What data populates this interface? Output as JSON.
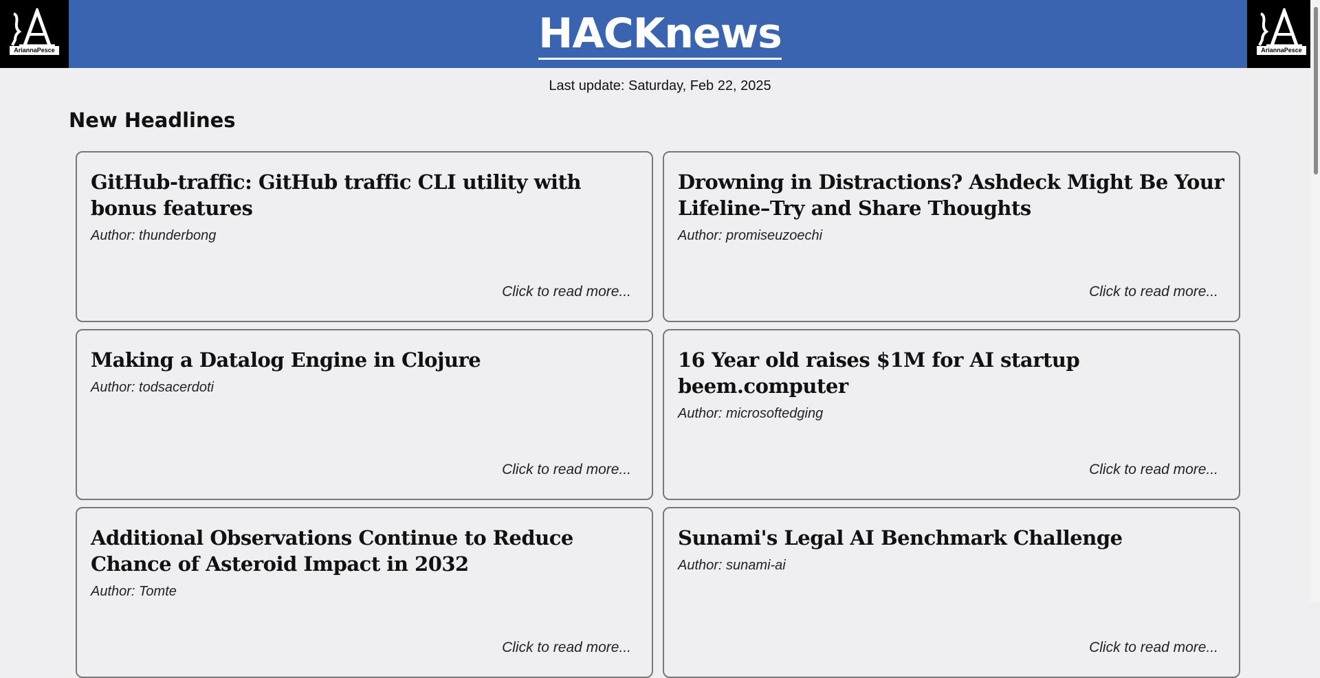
{
  "header": {
    "logo_text": "AriannaPesce",
    "title": "HACKnews"
  },
  "last_update": "Last update: Saturday, Feb 22, 2025",
  "section_title": "New Headlines",
  "cards": [
    {
      "title": "GitHub-traffic: GitHub traffic CLI utility with bonus features",
      "author": "Author: thunderbong",
      "read_more": "Click to read more..."
    },
    {
      "title": "Drowning in Distractions? Ashdeck Might Be Your Lifeline–Try and Share Thoughts",
      "author": "Author: promiseuzoechi",
      "read_more": "Click to read more..."
    },
    {
      "title": "Making a Datalog Engine in Clojure",
      "author": "Author: todsacerdoti",
      "read_more": "Click to read more..."
    },
    {
      "title": "16 Year old raises $1M for AI startup beem.computer",
      "author": "Author: microsoftedging",
      "read_more": "Click to read more..."
    },
    {
      "title": "Additional Observations Continue to Reduce Chance of Asteroid Impact in 2032",
      "author": "Author: Tomte",
      "read_more": "Click to read more..."
    },
    {
      "title": "Sunami's Legal AI Benchmark Challenge",
      "author": "Author: sunami-ai",
      "read_more": "Click to read more..."
    }
  ]
}
